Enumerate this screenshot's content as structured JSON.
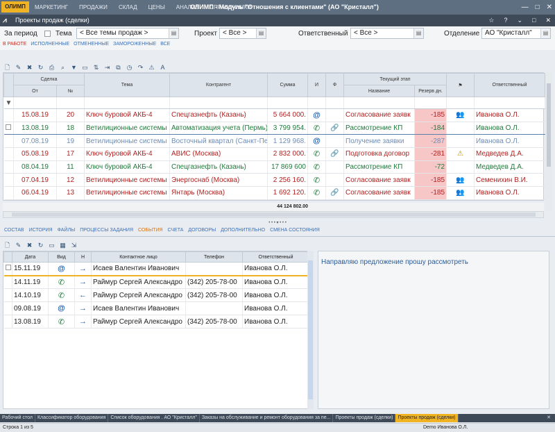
{
  "app": {
    "logo": "ОЛИМП",
    "menu": [
      "МАРКЕТИНГ",
      "ПРОДАЖИ",
      "СКЛАД",
      "ЦЕНЫ",
      "АНАЛИЗ",
      "СПРАВОЧНИКИ"
    ],
    "window_title": "ОЛИМП - Модуль \"Отношения с клиентами\" (АО \"Кристалл\")",
    "window_buttons": [
      "—",
      "□",
      "✕"
    ]
  },
  "document": {
    "title": "Проекты продаж (сделки)",
    "right_buttons": [
      "☆",
      "?",
      "⌄",
      "□",
      "✕"
    ]
  },
  "filters": {
    "period_label": "За период",
    "topic_label": "Тема",
    "topic_value": "< Все темы продаж >",
    "project_label": "Проект",
    "project_value": "< Все >",
    "responsible_label": "Ответственный",
    "responsible_value": "< Все >",
    "department_label": "Отделение",
    "department_value": "АО \"Кристалл\"",
    "state_tabs": [
      "В РАБОТЕ",
      "ИСПОЛНЕННЫЕ",
      "ОТМЕНЕННЫЕ",
      "ЗАМОРОЖЕННЫЕ",
      "ВСЕ"
    ]
  },
  "grid1": {
    "headers": {
      "deal": "Сделка",
      "date_from": "От",
      "number": "№",
      "topic": "Тема",
      "counterparty": "Контрагент",
      "sum": "Сумма",
      "i": "И",
      "f": "Ф",
      "current_stage": "Текущий этап",
      "stage_name": "Название",
      "reserve": "Резерв дн.",
      "responsible": "Ответственный"
    },
    "rows": [
      {
        "date": "15.08.19",
        "num": "20",
        "topic": "Ключ буровой АКБ-4",
        "counterparty": "Спецгазнефть (Казань)",
        "sum": "5 664 000.",
        "i": "@",
        "f": "",
        "stage": "Согласование заявк",
        "reserve": "-185",
        "flag": "👥",
        "resp": "Иванова О.Л."
      },
      {
        "date": "13.08.19",
        "num": "18",
        "topic": "Ветилиционные системы",
        "counterparty": "Автоматизация учета (Пермь)",
        "sum": "3 799 954.",
        "i": "✆",
        "f": "🔗",
        "stage": "Рассмотрение КП",
        "reserve": "-184",
        "flag": "",
        "resp": "Иванова О.Л."
      },
      {
        "date": "07.08.19",
        "num": "19",
        "topic": "Ветилиционные системы",
        "counterparty": "Восточный квартал (Санкт-Пе",
        "sum": "1 129 968.",
        "i": "@",
        "f": "",
        "stage": "Получение заявки",
        "reserve": "-287",
        "flag": "",
        "resp": "Иванова О.Л."
      },
      {
        "date": "05.08.19",
        "num": "17",
        "topic": "Ключ буровой АКБ-4",
        "counterparty": "АВИС (Москва)",
        "sum": "2 832 000.",
        "i": "✆",
        "f": "🔗",
        "stage": "Подготовка договор",
        "reserve": "-281",
        "flag": "⚠",
        "resp": "Медведев Д.А."
      },
      {
        "date": "08.04.19",
        "num": "11",
        "topic": "Ключ буровой АКБ-4",
        "counterparty": "Спецгазнефть (Казань)",
        "sum": "17 869 600",
        "i": "✆",
        "f": "",
        "stage": "Рассмотрение КП",
        "reserve": "-72",
        "flag": "",
        "resp": "Медведев Д.А."
      },
      {
        "date": "07.04.19",
        "num": "12",
        "topic": "Ветилиционные системы",
        "counterparty": "Энергоснаб (Москва)",
        "sum": "2 256 160.",
        "i": "✆",
        "f": "",
        "stage": "Согласование заявк",
        "reserve": "-185",
        "flag": "👥",
        "resp": "Семенихин В.И."
      },
      {
        "date": "06.04.19",
        "num": "13",
        "topic": "Ветилиционные системы",
        "counterparty": "Янтарь (Москва)",
        "sum": "1 692 120.",
        "i": "✆",
        "f": "🔗",
        "stage": "Согласование заявк",
        "reserve": "-185",
        "flag": "👥",
        "resp": "Иванова О.Л."
      }
    ],
    "total": "44 124 802.00"
  },
  "detail_tabs": [
    "СОСТАВ",
    "ИСТОРИЯ",
    "ФАЙЛЫ",
    "ПРОЦЕССЫ ЗАДАНИЯ",
    "СОБЫТИЯ",
    "СЧЕТА",
    "ДОГОВОРЫ",
    "ДОПОЛНИТЕЛЬНО",
    "СМЕНА СОСТОЯНИЯ"
  ],
  "grid2": {
    "headers": {
      "date": "Дата",
      "kind": "Вид",
      "n": "Н",
      "contact": "Контактное лицо",
      "phone": "Телефон",
      "responsible": "Ответственный"
    },
    "rows": [
      {
        "date": "15.11.19",
        "kind": "@",
        "dir": "→",
        "contact": "Исаев Валентин Иванович",
        "phone": "",
        "resp": "Иванова О.Л."
      },
      {
        "date": "14.11.19",
        "kind": "✆",
        "dir": "→",
        "contact": "Раймур Сергей Александро",
        "phone": "(342) 205-78-00",
        "resp": "Иванова О.Л."
      },
      {
        "date": "14.10.19",
        "kind": "✆",
        "dir": "←",
        "contact": "Раймур Сергей Александро",
        "phone": "(342) 205-78-00",
        "resp": "Иванова О.Л."
      },
      {
        "date": "09.08.19",
        "kind": "@",
        "dir": "→",
        "contact": "Исаев Валентин Иванович",
        "phone": "",
        "resp": "Иванова О.Л."
      },
      {
        "date": "13.08.19",
        "kind": "✆",
        "dir": "→",
        "contact": "Раймур Сергей Александро",
        "phone": "(342) 205-78-00",
        "resp": "Иванова О.Л."
      }
    ]
  },
  "comment": "Направляю предложение прошу рассмотреть",
  "taskbar": [
    "Рабочий стол",
    "Классификатор оборудования",
    "Список оборудования . АО \"Кристалл\"",
    "Заказы на обслуживание и ремонт оборудования за пе...",
    "Проекты продаж (сделки)",
    "Проекты продаж (сделки)"
  ],
  "status": {
    "rows": "Строка 1 из 5",
    "user": "Demo Иванова О.Л."
  }
}
